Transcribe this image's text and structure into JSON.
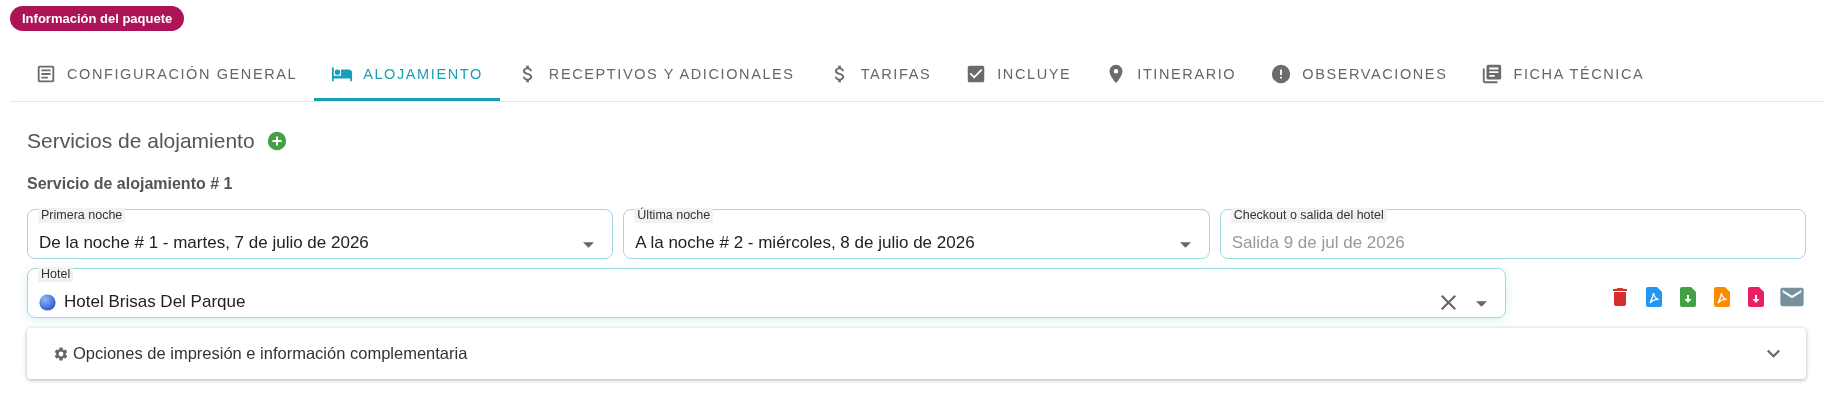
{
  "badge": "Información del paquete",
  "tabs": [
    {
      "label": "CONFIGURACIÓN GENERAL",
      "kind": "document",
      "selected": false
    },
    {
      "label": "ALOJAMIENTO",
      "kind": "bed",
      "selected": true
    },
    {
      "label": "RECEPTIVOS Y ADICIONALES",
      "kind": "dollar",
      "selected": false
    },
    {
      "label": "TARIFAS",
      "kind": "dollar",
      "selected": false
    },
    {
      "label": "INCLUYE",
      "kind": "checkbox",
      "selected": false
    },
    {
      "label": "ITINERARIO",
      "kind": "pin",
      "selected": false
    },
    {
      "label": "OBSERVACIONES",
      "kind": "alert",
      "selected": false
    },
    {
      "label": "FICHA TÉCNICA",
      "kind": "library",
      "selected": false
    }
  ],
  "section": {
    "title": "Servicios de alojamiento",
    "service_title": "Servicio de alojamiento # 1"
  },
  "fields": [
    {
      "kind": "select",
      "label": "Primera noche",
      "value": "De la noche # 1 - martes, 7 de julio de 2026"
    },
    {
      "kind": "select",
      "label": "Última noche",
      "value": "A la noche # 2 - miércoles, 8 de julio de 2026"
    },
    {
      "kind": "text",
      "label": "Checkout o salida del hotel",
      "placeholder": "Salida 9 de jul de 2026"
    }
  ],
  "hotel": {
    "label": "Hotel",
    "value": "Hotel Brisas Del Parque"
  },
  "actions": [
    {
      "kind": "delete",
      "color": "#d32f2f"
    },
    {
      "kind": "pdf",
      "color": "#2196f3"
    },
    {
      "kind": "download",
      "color": "#43a047"
    },
    {
      "kind": "pdf",
      "color": "#fb8c00"
    },
    {
      "kind": "download",
      "color": "#e91e63"
    },
    {
      "kind": "mail",
      "color": "#78909c"
    }
  ],
  "panel": {
    "title": "Opciones de impresión e información complementaria",
    "expanded": false
  }
}
